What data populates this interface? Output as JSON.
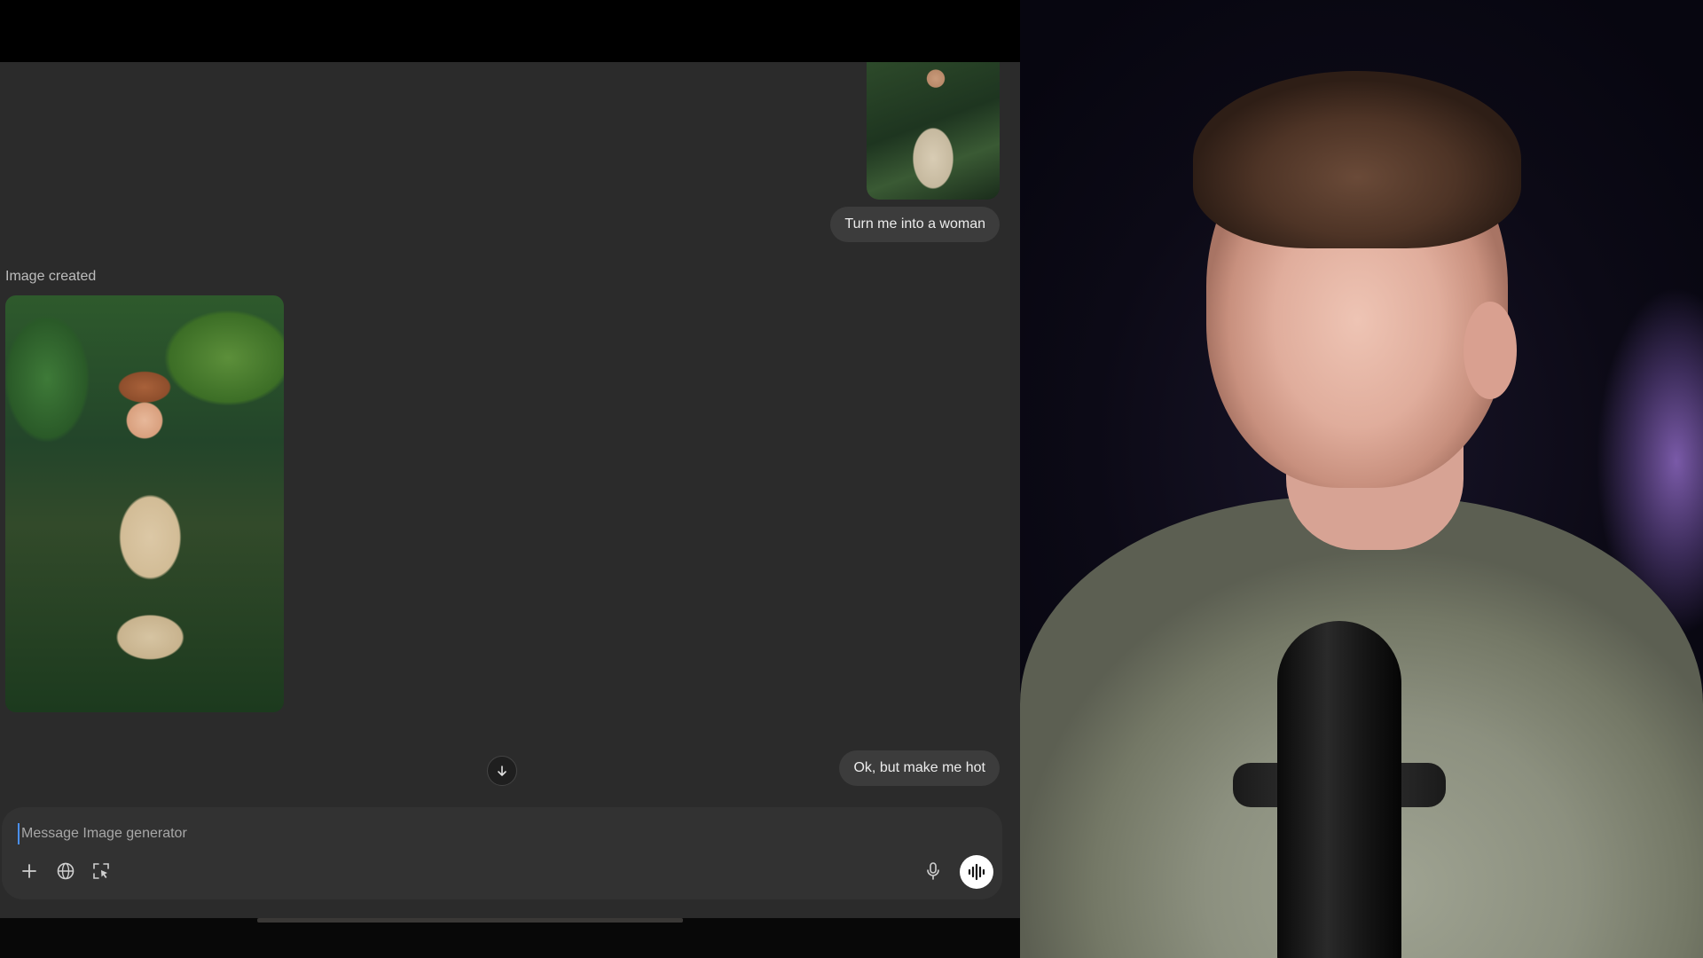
{
  "chat": {
    "messages": [
      {
        "role": "user",
        "text": "Turn me into a woman"
      },
      {
        "role": "assistant",
        "label": "Image created"
      },
      {
        "role": "user",
        "text": "Ok, but make me hot"
      }
    ]
  },
  "composer": {
    "placeholder": "Message Image generator"
  },
  "icons": {
    "add": "plus-icon",
    "web": "globe-icon",
    "select": "select-area-icon",
    "mic": "microphone-icon",
    "voice": "voice-waveform-icon",
    "scroll": "arrow-down-icon"
  }
}
